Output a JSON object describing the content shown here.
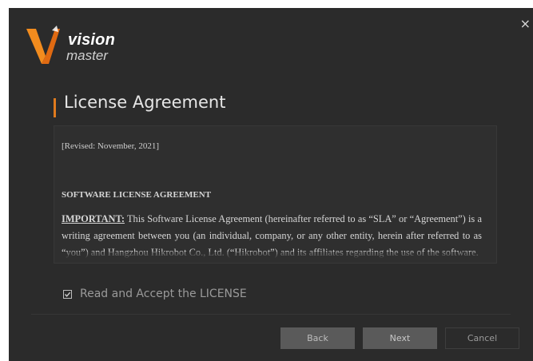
{
  "app": {
    "logo_word1": "vision",
    "logo_word2": "master",
    "close_glyph": "×"
  },
  "page": {
    "title": "License Agreement"
  },
  "license": {
    "revised": "[Revised: November, 2021]",
    "heading": "SOFTWARE LICENSE AGREEMENT",
    "important_label": "IMPORTANT:",
    "paragraph": " This Software License Agreement (hereinafter referred to as “SLA” or “Agreement”) is a writing agreement between you (an individual, company, or any other entity, herein after referred to as “you”) and Hangzhou Hikrobot Co., Ltd. (“Hikrobot”) and its affiliates regarding the use of the software."
  },
  "accept": {
    "label": "Read and Accept the LICENSE",
    "checked": true
  },
  "buttons": {
    "back": "Back",
    "next": "Next",
    "cancel": "Cancel"
  },
  "colors": {
    "accent": "#e07b1e",
    "window_bg": "#2b2b2b",
    "button_bg": "#5a5a5a"
  }
}
